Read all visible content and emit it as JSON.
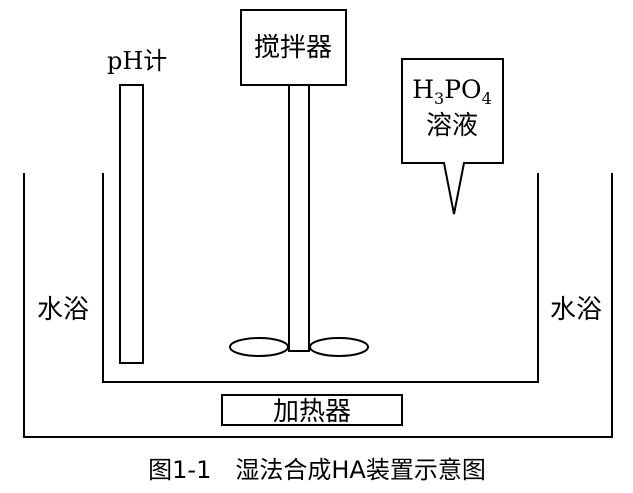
{
  "labels": {
    "stirrer": "搅拌器",
    "ph_meter": "pH计",
    "acid_formula": {
      "p1": "H",
      "sub1": "3",
      "p2": "PO",
      "sub2": "4"
    },
    "solution": "溶液",
    "water_bath_left": "水浴",
    "water_bath_right": "水浴",
    "heater": "加热器"
  },
  "caption": "图1-1　湿法合成HA装置示意图"
}
